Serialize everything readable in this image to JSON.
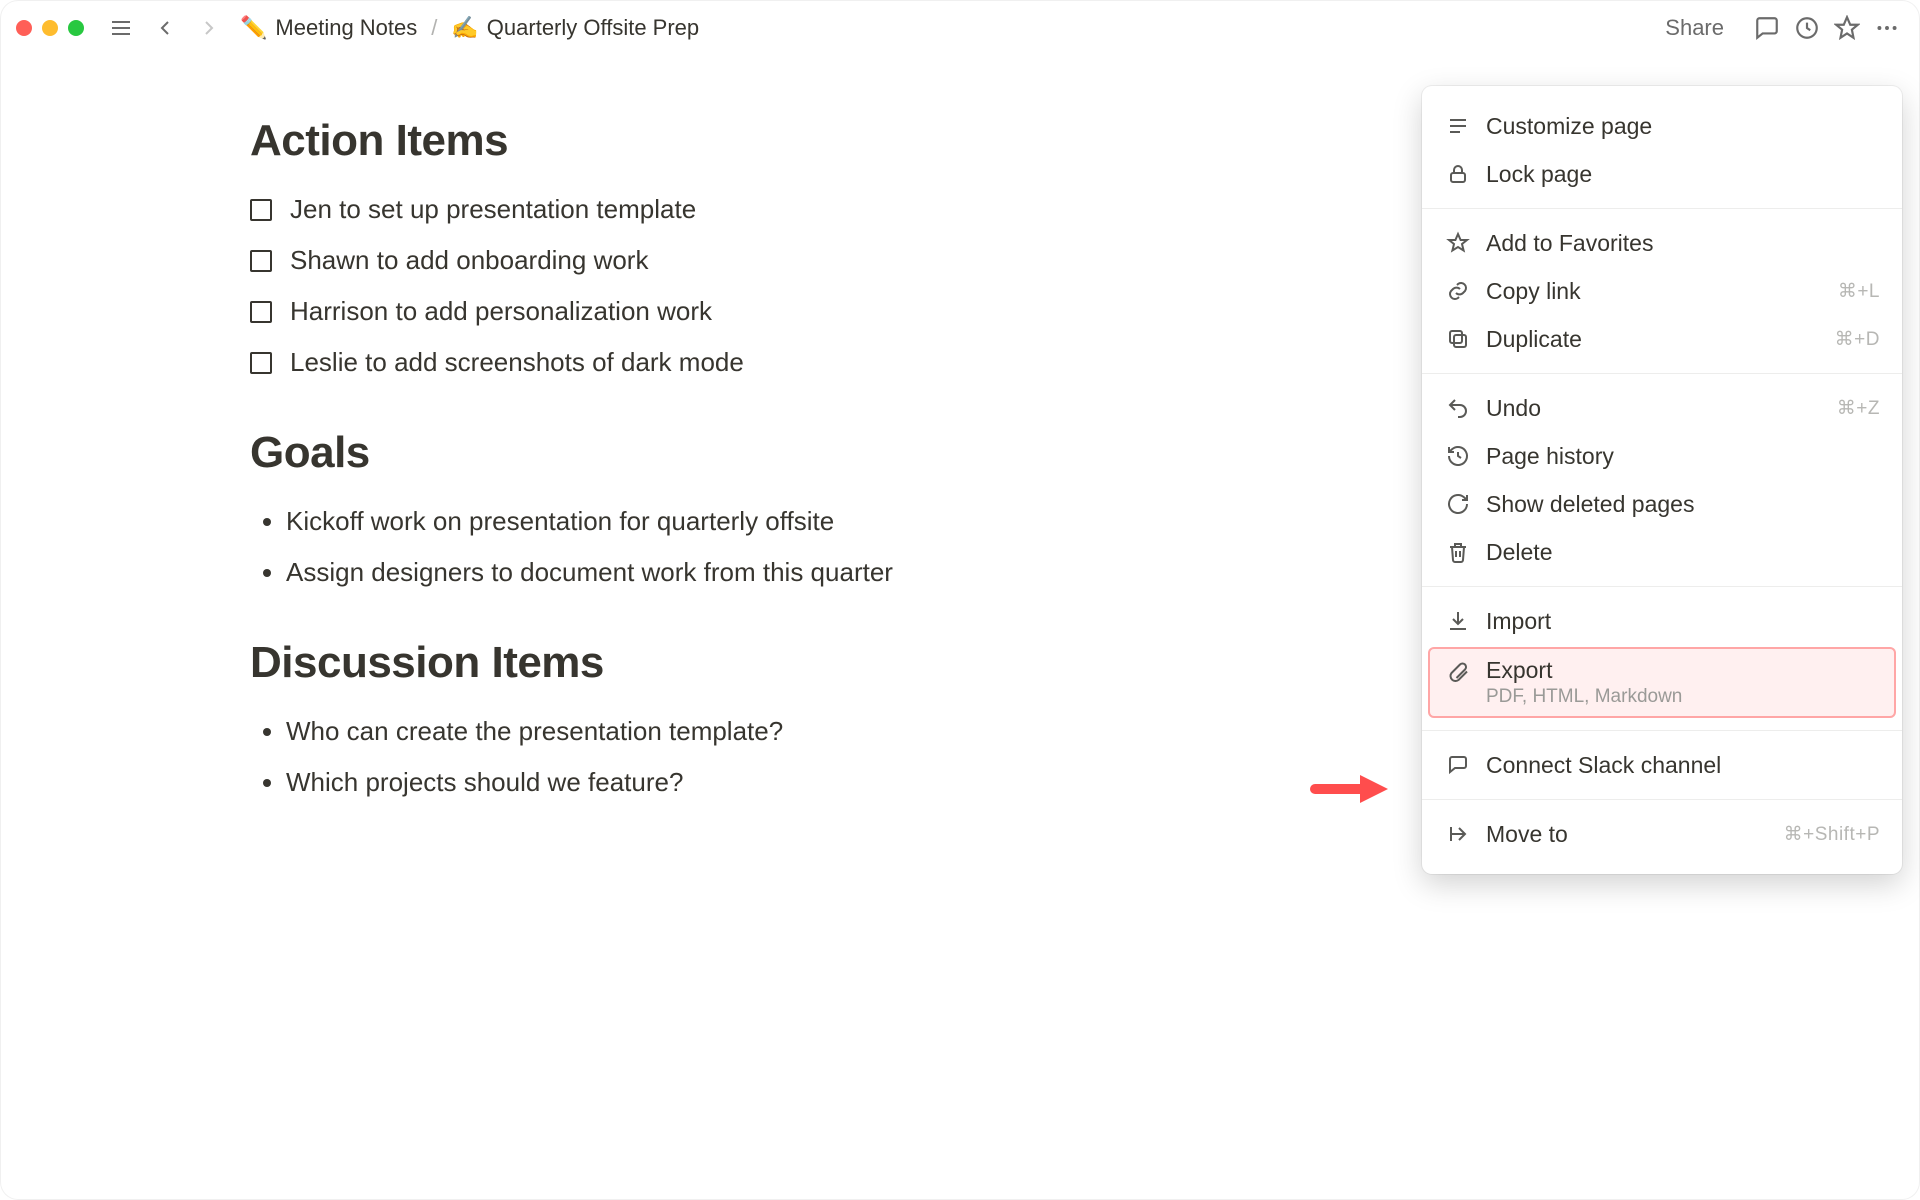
{
  "breadcrumbs": {
    "parent_emoji": "✏️",
    "parent": "Meeting Notes",
    "sep": "/",
    "current_emoji": "✍️",
    "current": "Quarterly Offsite Prep"
  },
  "topbar": {
    "share": "Share"
  },
  "sections": {
    "action_items": {
      "title": "Action Items",
      "items": [
        "Jen to set up presentation template",
        "Shawn to add onboarding work",
        "Harrison to add personalization work",
        "Leslie to add screenshots of dark mode"
      ]
    },
    "goals": {
      "title": "Goals",
      "items": [
        "Kickoff work on presentation for quarterly offsite",
        "Assign designers to document work from this quarter"
      ]
    },
    "discussion": {
      "title": "Discussion Items",
      "items": [
        "Who can create the presentation template?",
        "Which projects should we feature?"
      ]
    }
  },
  "menu": {
    "customize": "Customize page",
    "lock": "Lock page",
    "favorites": "Add to Favorites",
    "copylink": {
      "label": "Copy link",
      "shortcut": "⌘+L"
    },
    "duplicate": {
      "label": "Duplicate",
      "shortcut": "⌘+D"
    },
    "undo": {
      "label": "Undo",
      "shortcut": "⌘+Z"
    },
    "history": "Page history",
    "showdeleted": "Show deleted pages",
    "delete": "Delete",
    "import": "Import",
    "export": {
      "label": "Export",
      "sub": "PDF, HTML, Markdown"
    },
    "slack": "Connect Slack channel",
    "moveto": {
      "label": "Move to",
      "shortcut": "⌘+Shift+P"
    }
  }
}
